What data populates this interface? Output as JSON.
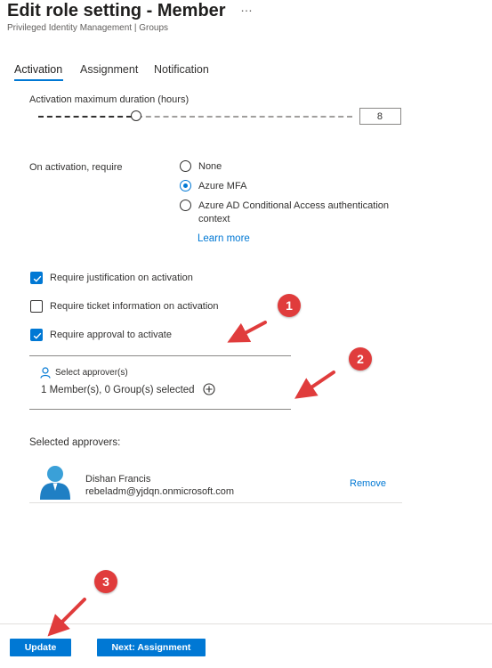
{
  "header": {
    "title": "Edit role setting - Member",
    "more_icon": "…",
    "subtitle": "Privileged Identity Management | Groups"
  },
  "tabs": [
    {
      "label": "Activation",
      "active": true
    },
    {
      "label": "Assignment",
      "active": false
    },
    {
      "label": "Notification",
      "active": false
    }
  ],
  "activation": {
    "duration_label": "Activation maximum duration (hours)",
    "duration_value": "8",
    "slider_fraction": 0.3,
    "require_label": "On activation, require",
    "options": [
      {
        "label": "None",
        "checked": false
      },
      {
        "label": "Azure MFA",
        "checked": true
      },
      {
        "label": "Azure AD Conditional Access authentication",
        "label2": "context",
        "checked": false
      }
    ],
    "learn_more": "Learn more",
    "checks": [
      {
        "label": "Require justification on activation",
        "checked": true
      },
      {
        "label": "Require ticket information on activation",
        "checked": false
      },
      {
        "label": "Require approval to activate",
        "checked": true
      }
    ],
    "approver_label": "Select approver(s)",
    "approver_summary": "1 Member(s), 0 Group(s) selected",
    "selected_approvers_label": "Selected approvers:",
    "approvers": [
      {
        "name": "Dishan Francis",
        "email": "rebeladm@yjdqn.onmicrosoft.com",
        "action": "Remove"
      }
    ]
  },
  "footer": {
    "update_label": "Update",
    "next_label": "Next: Assignment"
  },
  "annotations": [
    "1",
    "2",
    "3"
  ],
  "colors": {
    "accent": "#0078d4",
    "annotation": "#e03c3c"
  }
}
